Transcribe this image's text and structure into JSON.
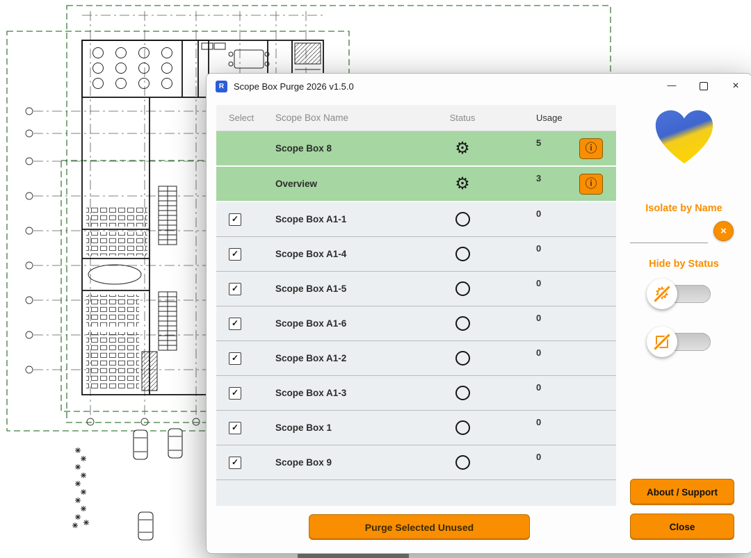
{
  "window": {
    "title": "Scope Box Purge 2026 v1.5.0",
    "app_icon_letter": "R"
  },
  "icons": {
    "gear": "⚙",
    "info": "ⓘ",
    "check": "✓",
    "close": "×",
    "clear": "×",
    "minimize": "—"
  },
  "table": {
    "headers": {
      "select": "Select",
      "name": "Scope Box Name",
      "status": "Status",
      "usage": "Usage"
    },
    "rows": [
      {
        "name": "Scope Box 8",
        "usage": "5",
        "status": "used",
        "highlighted": true
      },
      {
        "name": "Overview",
        "usage": "3",
        "status": "used",
        "highlighted": true
      },
      {
        "name": "Scope Box A1-1",
        "usage": "0",
        "status": "unused",
        "selected": true
      },
      {
        "name": "Scope Box A1-4",
        "usage": "0",
        "status": "unused",
        "selected": true
      },
      {
        "name": "Scope Box A1-5",
        "usage": "0",
        "status": "unused",
        "selected": true
      },
      {
        "name": "Scope Box A1-6",
        "usage": "0",
        "status": "unused",
        "selected": true
      },
      {
        "name": "Scope Box A1-2",
        "usage": "0",
        "status": "unused",
        "selected": true
      },
      {
        "name": "Scope Box A1-3",
        "usage": "0",
        "status": "unused",
        "selected": true
      },
      {
        "name": "Scope Box 1",
        "usage": "0",
        "status": "unused",
        "selected": true
      },
      {
        "name": "Scope Box 9",
        "usage": "0",
        "status": "unused",
        "selected": true
      }
    ]
  },
  "sidebar": {
    "isolate_label": "Isolate by Name",
    "isolate_value": "",
    "hide_label": "Hide by Status",
    "about_button": "About / Support",
    "close_button": "Close"
  },
  "footer": {
    "purge_button": "Purge Selected Unused"
  },
  "colors": {
    "accent_orange": "#F98E00",
    "row_green": "#A6D6A1",
    "row_gray": "#ECEFF1",
    "heart_blue": "#3F66CF",
    "heart_yellow": "#FFD400"
  }
}
